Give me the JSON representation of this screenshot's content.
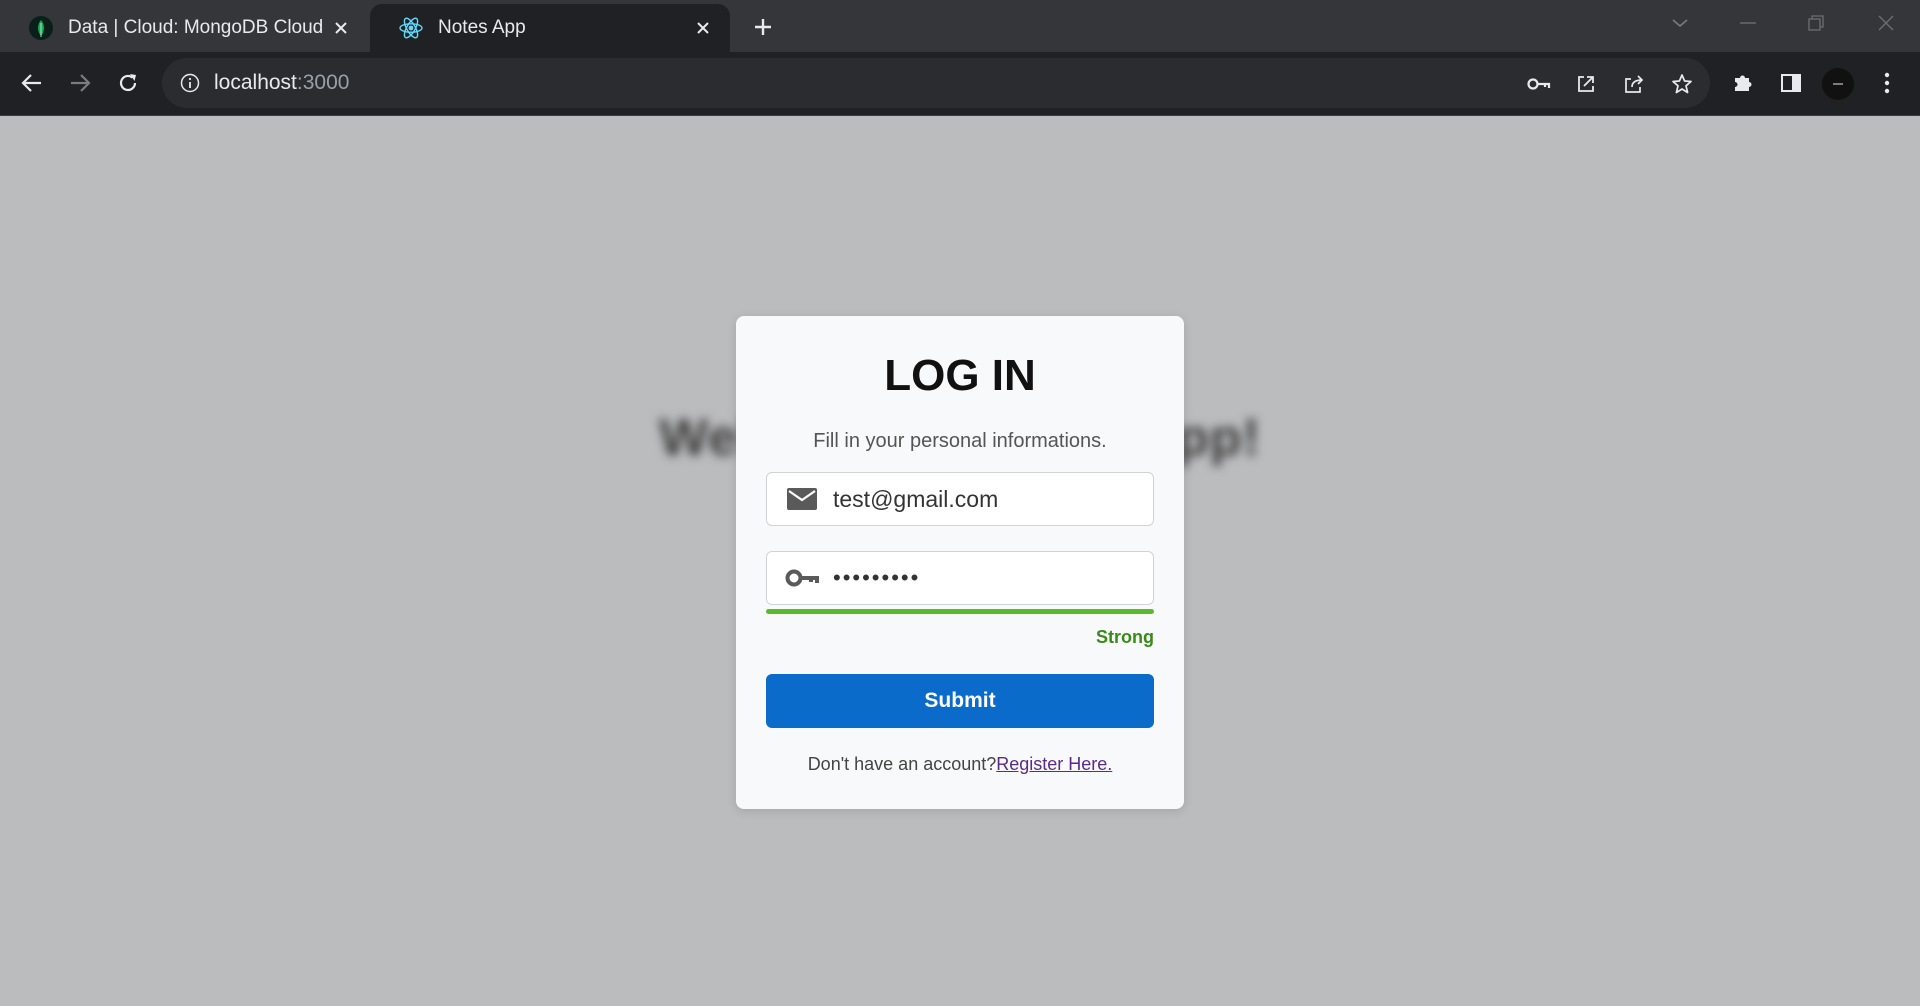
{
  "browser": {
    "tabs": [
      {
        "title": "Data | Cloud: MongoDB Cloud",
        "icon": "mongodb-leaf-icon",
        "active": false
      },
      {
        "title": "Notes App",
        "icon": "react-icon",
        "active": true
      }
    ],
    "url_host": "localhost",
    "url_port": ":3000"
  },
  "page": {
    "background_heading": "Welcome to Notes App!"
  },
  "login": {
    "title": "LOG IN",
    "subtitle": "Fill in your personal informations.",
    "email_value": "test@gmail.com",
    "password_value": "•••••••••",
    "strength_label": "Strong",
    "strength_level": 1.0,
    "submit_label": "Submit",
    "footer_prompt": "Don't have an account?",
    "register_link": "Register Here."
  },
  "colors": {
    "accent": "#0b6bcb",
    "strength": "#5cb82e",
    "link": "#5b2a86"
  }
}
